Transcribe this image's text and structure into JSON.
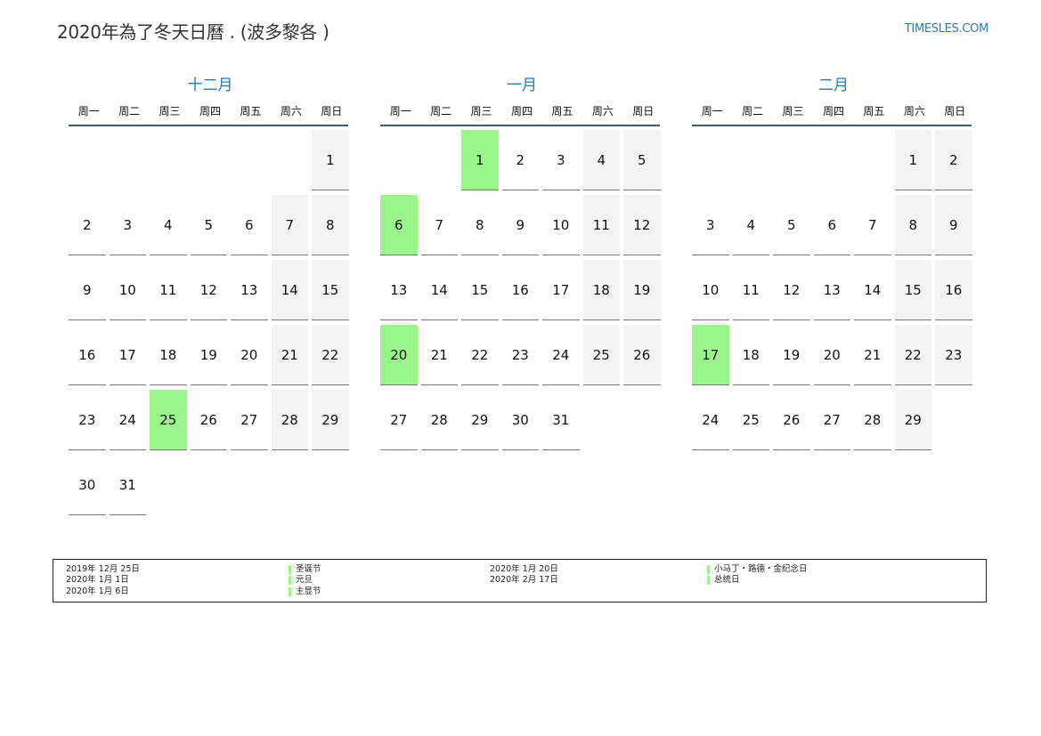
{
  "header": {
    "title": "2020年為了冬天日曆 . (波多黎各 )",
    "site": "TIMESLES.COM"
  },
  "weekdays": [
    "周一",
    "周二",
    "周三",
    "周四",
    "周五",
    "周六",
    "周日"
  ],
  "colors": {
    "accent": "#2a7ab5",
    "holiday": "#9af58a",
    "weekend": "#f3f3f3",
    "rule": "#3d5a78"
  },
  "months": [
    {
      "name": "十二月",
      "lead_blanks": 6,
      "days": 31,
      "holidays": [
        25
      ]
    },
    {
      "name": "一月",
      "lead_blanks": 2,
      "days": 31,
      "holidays": [
        1,
        6,
        20
      ]
    },
    {
      "name": "二月",
      "lead_blanks": 5,
      "days": 29,
      "holidays": [
        17
      ]
    }
  ],
  "legend": {
    "dates_left": [
      "2019年 12月 25日",
      "2020年 1月 1日",
      "2020年 1月 6日"
    ],
    "names_left": [
      "圣诞节",
      "元旦",
      "主显节"
    ],
    "dates_right": [
      "2020年 1月 20日",
      "2020年 2月 17日"
    ],
    "names_right": [
      "小马丁・路德・金纪念日",
      "总统日"
    ]
  }
}
